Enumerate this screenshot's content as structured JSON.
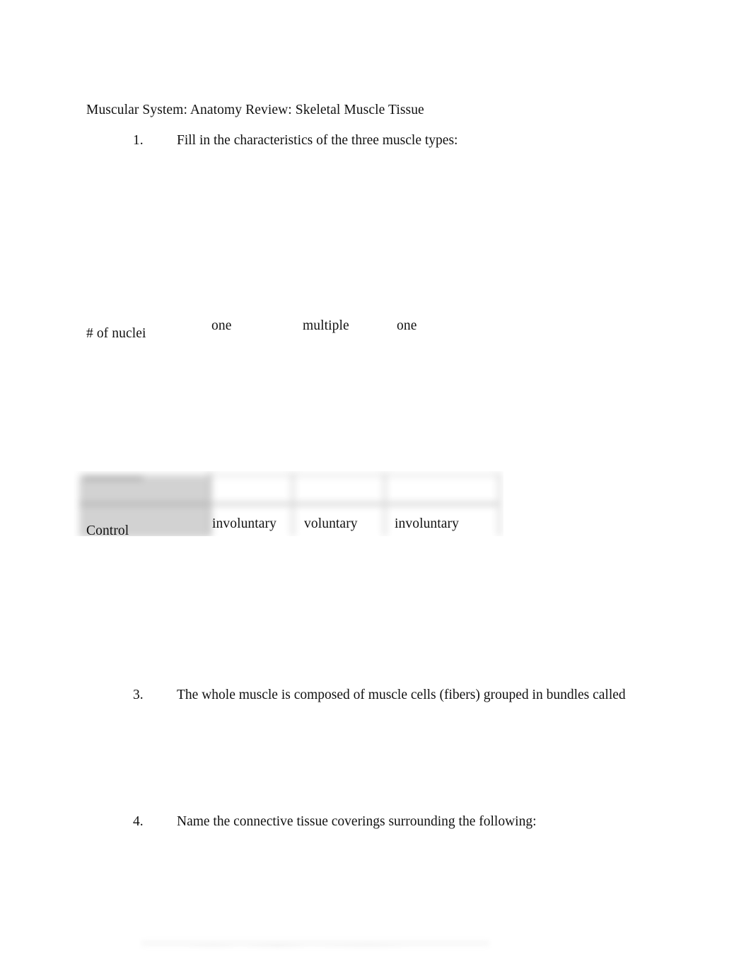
{
  "document": {
    "title": "Muscular System: Anatomy Review: Skeletal Muscle Tissue"
  },
  "items": [
    {
      "number": "1.",
      "text": "Fill in the characteristics of the three muscle types:"
    },
    {
      "number": "3.",
      "text": "The whole muscle is composed of muscle cells (fibers) grouped in bundles called"
    },
    {
      "number": "4.",
      "text": "Name the connective tissue coverings surrounding the following:"
    }
  ],
  "muscle_table": {
    "rows": [
      {
        "label": "# of nuclei",
        "cells": [
          "one",
          "multiple",
          "one"
        ]
      },
      {
        "label": "Control",
        "cells": [
          "involuntary",
          "voluntary",
          "involuntary"
        ]
      }
    ]
  },
  "colors": {
    "page_background": "#ffffff",
    "text": "#111111",
    "table_cell_shading": "#d2d2d2",
    "table_gridline": "#d8d8d8",
    "faint_rule": "#ececec"
  }
}
